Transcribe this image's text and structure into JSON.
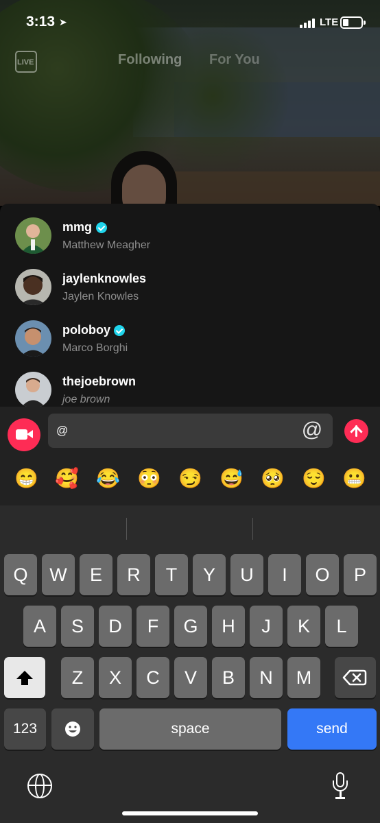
{
  "status_bar": {
    "time": "3:13",
    "network": "LTE"
  },
  "feed_tabs": {
    "live_label": "LIVE",
    "following": "Following",
    "for_you": "For You"
  },
  "mention_suggestions": [
    {
      "handle": "mmg",
      "name": "Matthew Meagher",
      "verified": true
    },
    {
      "handle": "jaylenknowles",
      "name": "Jaylen Knowles",
      "verified": false
    },
    {
      "handle": "poloboy",
      "name": "Marco Borghi",
      "verified": true
    },
    {
      "handle": "thejoebrown",
      "name": "joe brown",
      "verified": false
    }
  ],
  "comment_input": {
    "value": "@",
    "at_symbol": "@"
  },
  "emojis": [
    "😁",
    "🥰",
    "😂",
    "😳",
    "😏",
    "😅",
    "🥺",
    "😌",
    "😬"
  ],
  "keyboard": {
    "row1": [
      "Q",
      "W",
      "E",
      "R",
      "T",
      "Y",
      "U",
      "I",
      "O",
      "P"
    ],
    "row2": [
      "A",
      "S",
      "D",
      "F",
      "G",
      "H",
      "J",
      "K",
      "L"
    ],
    "row3": [
      "Z",
      "X",
      "C",
      "V",
      "B",
      "N",
      "M"
    ],
    "numbers_key": "123",
    "space_key": "space",
    "send_key": "send"
  },
  "colors": {
    "accent": "#fe2c55",
    "verified": "#20d5ec",
    "send_key": "#3478f6"
  }
}
